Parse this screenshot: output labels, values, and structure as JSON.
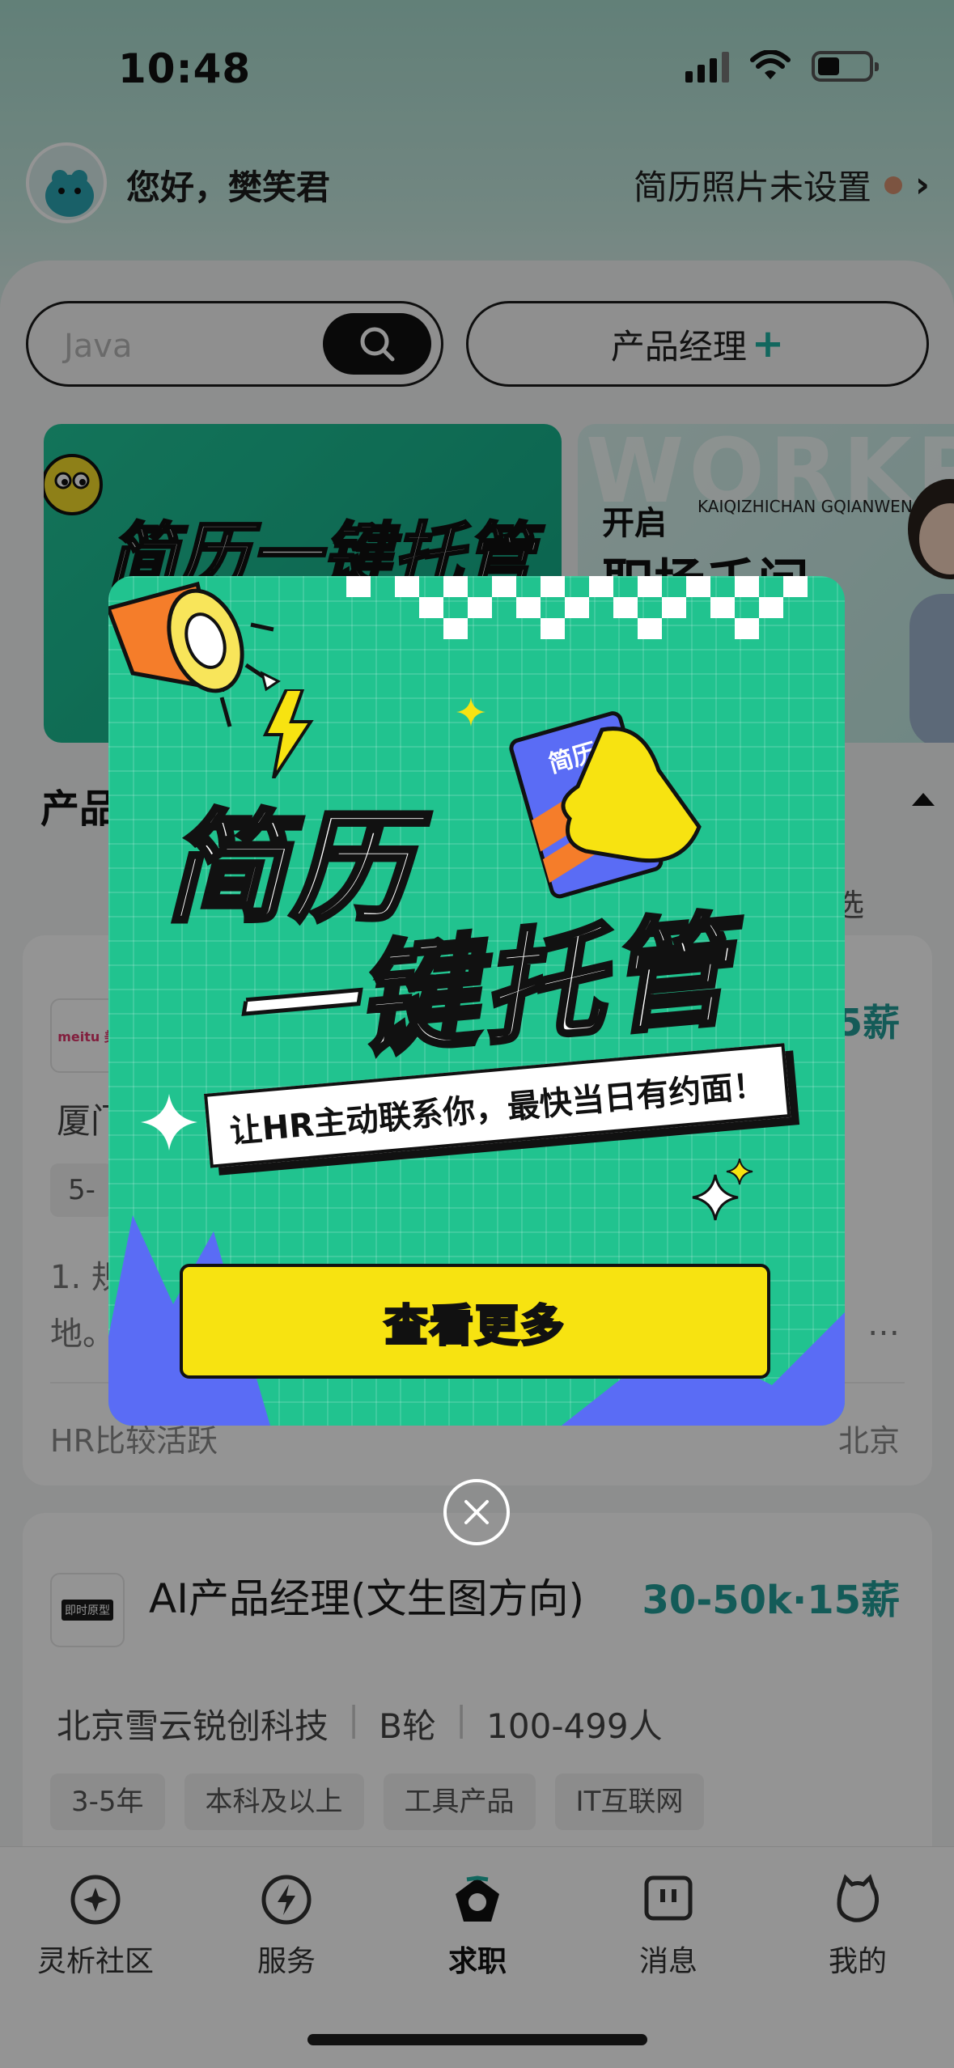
{
  "status_bar": {
    "time": "10:48"
  },
  "header": {
    "greeting": "您好，樊笑君",
    "photo_tip": "简历照片未设置",
    "chevron": "›"
  },
  "search": {
    "placeholder": "Java"
  },
  "job_filter": {
    "label": "产品经理",
    "plus": "+"
  },
  "banners": {
    "left_title": "简历一键托管",
    "right_watermark": "WORKP",
    "right_kai": "开启",
    "right_pinyin": "KAIQIZHICHAN GQIANWEN",
    "right_big": "职场千问"
  },
  "section": {
    "title": "产品",
    "filter": "选"
  },
  "job_cards": [
    {
      "logo_text": "meitu 美",
      "salary_tail": "5薪",
      "company": "厦门",
      "tag": "5-",
      "desc_line1": "1. 规",
      "desc_line2": "地。",
      "desc_tail": "…",
      "hr_status": "HR比较活跃",
      "city": "北京"
    },
    {
      "logo_text": "即时原型",
      "title": "AI产品经理(文生图方向)",
      "salary": "30-50k·15薪",
      "company_name": "北京雪云锐创科技",
      "stage": "B轮",
      "size": "100-499人",
      "tags": [
        "3-5年",
        "本科及以上",
        "工具产品",
        "IT互联网"
      ]
    }
  ],
  "tabbar": {
    "items": [
      {
        "label": "灵析社区",
        "icon": "compass-icon"
      },
      {
        "label": "服务",
        "icon": "lightning-icon"
      },
      {
        "label": "求职",
        "icon": "job-icon"
      },
      {
        "label": "消息",
        "icon": "message-icon"
      },
      {
        "label": "我的",
        "icon": "profile-icon"
      }
    ],
    "active_index": 2
  },
  "popup": {
    "title_part1_yellow": "简历",
    "title_part2": "一键托管",
    "card_label": "简历",
    "slogan": "让HR主动联系你，最快当日有约面！",
    "cta": "查看更多",
    "close": "×"
  },
  "colors": {
    "accent": "#239e98",
    "popup_green": "#21c38f",
    "cta_yellow": "#f7e311",
    "blue": "#5a6cf5"
  }
}
